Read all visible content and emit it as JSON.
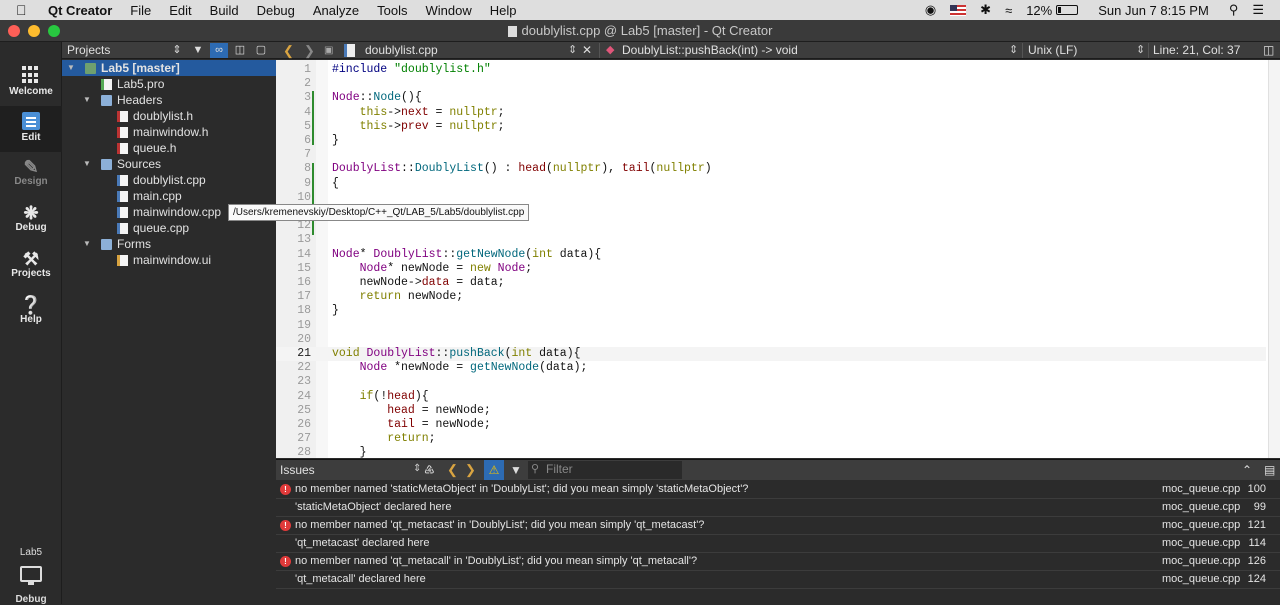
{
  "menubar": {
    "app_name": "Qt Creator",
    "items": [
      "File",
      "Edit",
      "Build",
      "Debug",
      "Analyze",
      "Tools",
      "Window",
      "Help"
    ],
    "battery": "12%",
    "datetime": "Sun Jun 7  8:15 PM"
  },
  "window": {
    "title": "doublylist.cpp @ Lab5 [master] - Qt Creator"
  },
  "modes": {
    "welcome": "Welcome",
    "edit": "Edit",
    "design": "Design",
    "debug": "Debug",
    "projects": "Projects",
    "help": "Help",
    "kit_name": "Lab5",
    "kit_mode": "Debug"
  },
  "projects_panel": {
    "title": "Projects",
    "tree": [
      {
        "label": "Lab5 [master]",
        "icon": "project",
        "level": 0,
        "expanded": true,
        "selected": true
      },
      {
        "label": "Lab5.pro",
        "icon": "pro-file",
        "level": 1
      },
      {
        "label": "Headers",
        "icon": "folder",
        "level": 1,
        "expanded": true
      },
      {
        "label": "doublylist.h",
        "icon": "header-file",
        "level": 2
      },
      {
        "label": "mainwindow.h",
        "icon": "header-file",
        "level": 2
      },
      {
        "label": "queue.h",
        "icon": "header-file",
        "level": 2
      },
      {
        "label": "Sources",
        "icon": "folder",
        "level": 1,
        "expanded": true
      },
      {
        "label": "doublylist.cpp",
        "icon": "cpp-file",
        "level": 2
      },
      {
        "label": "main.cpp",
        "icon": "cpp-file",
        "level": 2
      },
      {
        "label": "mainwindow.cpp",
        "icon": "cpp-file",
        "level": 2
      },
      {
        "label": "queue.cpp",
        "icon": "cpp-file",
        "level": 2
      },
      {
        "label": "Forms",
        "icon": "folder",
        "level": 1,
        "expanded": true
      },
      {
        "label": "mainwindow.ui",
        "icon": "ui-file",
        "level": 2
      }
    ],
    "tooltip": "/Users/kremenevskiy/Desktop/C++_Qt/LAB_5/Lab5/doublylist.cpp"
  },
  "editor_toolbar": {
    "file_name": "doublylist.cpp",
    "symbol": "DoublyList::pushBack(int) -> void",
    "line_endings": "Unix (LF)",
    "cursor_position": "Line: 21, Col: 37"
  },
  "editor": {
    "current_line": 21,
    "lines": [
      {
        "n": "1",
        "html": "<span class='k-pp'>#include</span> <span class='k-str'>\"doublylist.h\"</span>"
      },
      {
        "n": "2",
        "html": ""
      },
      {
        "n": "3",
        "html": "<span class='k-type'>Node</span>::<span class='k-fn'>Node</span>(){"
      },
      {
        "n": "4",
        "html": "    <span class='k-kw'>this</span>-><span class='k-mem'>next</span> = <span class='k-kw'>nullptr</span>;"
      },
      {
        "n": "5",
        "html": "    <span class='k-kw'>this</span>-><span class='k-mem'>prev</span> = <span class='k-kw'>nullptr</span>;"
      },
      {
        "n": "6",
        "html": "}"
      },
      {
        "n": "7",
        "html": ""
      },
      {
        "n": "8",
        "html": "<span class='k-type'>DoublyList</span>::<span class='k-fn'>DoublyList</span>() : <span class='k-mem'>head</span>(<span class='k-kw'>nullptr</span>), <span class='k-mem'>tail</span>(<span class='k-kw'>nullptr</span>)"
      },
      {
        "n": "9",
        "html": "{"
      },
      {
        "n": "10",
        "html": ""
      },
      {
        "n": "11",
        "html": ""
      },
      {
        "n": "12",
        "html": ""
      },
      {
        "n": "13",
        "html": ""
      },
      {
        "n": "14",
        "html": "<span class='k-type'>Node</span>* <span class='k-type'>DoublyList</span>::<span class='k-fn'>getNewNode</span>(<span class='k-kw'>int</span> data){"
      },
      {
        "n": "15",
        "html": "    <span class='k-type'>Node</span>* newNode = <span class='k-kw'>new</span> <span class='k-type'>Node</span>;"
      },
      {
        "n": "16",
        "html": "    newNode-><span class='k-mem'>data</span> = data;"
      },
      {
        "n": "17",
        "html": "    <span class='k-kw'>return</span> newNode;"
      },
      {
        "n": "18",
        "html": "}"
      },
      {
        "n": "19",
        "html": ""
      },
      {
        "n": "20",
        "html": ""
      },
      {
        "n": "21",
        "html": "<span class='k-kw'>void</span> <span class='k-type'>DoublyList</span>::<span class='k-fn'>pushBack</span>(<span class='k-kw'>int</span> data){"
      },
      {
        "n": "22",
        "html": "    <span class='k-type'>Node</span> *newNode = <span class='k-fn'>getNewNode</span>(data);"
      },
      {
        "n": "23",
        "html": ""
      },
      {
        "n": "24",
        "html": "    <span class='k-kw'>if</span>(!<span class='k-mem'>head</span>){"
      },
      {
        "n": "25",
        "html": "        <span class='k-mem'>head</span> = newNode;"
      },
      {
        "n": "26",
        "html": "        <span class='k-mem'>tail</span> = newNode;"
      },
      {
        "n": "27",
        "html": "        <span class='k-kw'>return</span>;"
      },
      {
        "n": "28",
        "html": "    }"
      }
    ]
  },
  "issues_panel": {
    "title": "Issues",
    "filter_placeholder": "Filter",
    "rows": [
      {
        "type": "error",
        "message": "no member named 'staticMetaObject' in 'DoublyList'; did you mean simply 'staticMetaObject'?",
        "file": "moc_queue.cpp",
        "line": "100"
      },
      {
        "type": "note",
        "message": "'staticMetaObject' declared here",
        "file": "moc_queue.cpp",
        "line": "99"
      },
      {
        "type": "error",
        "message": "no member named 'qt_metacast' in 'DoublyList'; did you mean simply 'qt_metacast'?",
        "file": "moc_queue.cpp",
        "line": "121"
      },
      {
        "type": "note",
        "message": "'qt_metacast' declared here",
        "file": "moc_queue.cpp",
        "line": "114"
      },
      {
        "type": "error",
        "message": "no member named 'qt_metacall' in 'DoublyList'; did you mean simply 'qt_metacall'?",
        "file": "moc_queue.cpp",
        "line": "126"
      },
      {
        "type": "note",
        "message": "'qt_metacall' declared here",
        "file": "moc_queue.cpp",
        "line": "124"
      }
    ]
  },
  "colors": {
    "accent": "#245a9e",
    "error": "#e03a3a",
    "nav_arrow": "#d9a441",
    "close_light": "#fe5f57",
    "minimize_light": "#febc2e",
    "zoom_light": "#28c840"
  }
}
